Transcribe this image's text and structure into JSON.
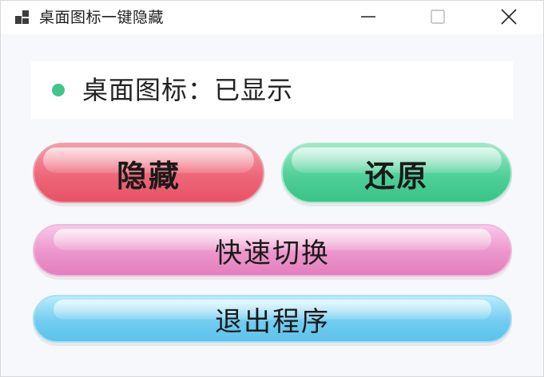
{
  "window": {
    "title": "桌面图标一键隐藏",
    "icons": {
      "app": "app-grid-icon",
      "minimize": "minimize-icon",
      "maximize": "maximize-icon",
      "close": "close-icon"
    }
  },
  "status": {
    "text": "桌面图标：已显示",
    "dot_color": "#42c48b"
  },
  "buttons": {
    "hide": {
      "label": "隐藏",
      "color": "#ee6779"
    },
    "restore": {
      "label": "还原",
      "color": "#4fd09a"
    },
    "toggle": {
      "label": "快速切换",
      "color": "#ec95cb"
    },
    "exit": {
      "label": "退出程序",
      "color": "#72cdf0"
    }
  }
}
